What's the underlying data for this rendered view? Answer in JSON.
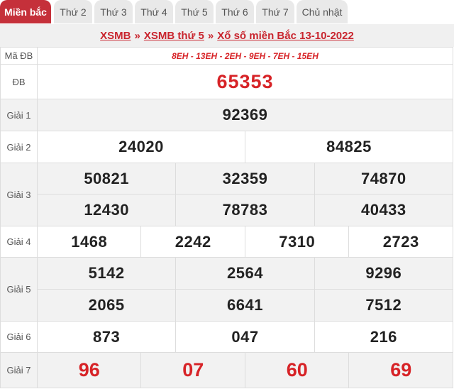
{
  "tabs": [
    {
      "label": "Miền bắc",
      "active": true
    },
    {
      "label": "Thứ 2"
    },
    {
      "label": "Thứ 3"
    },
    {
      "label": "Thứ 4"
    },
    {
      "label": "Thứ 5"
    },
    {
      "label": "Thứ 6"
    },
    {
      "label": "Thứ 7"
    },
    {
      "label": "Chủ nhật"
    }
  ],
  "breadcrumb": {
    "item1": "XSMB",
    "sep": "»",
    "item2": "XSMB thứ 5",
    "item3": "Xổ số miền Bắc 13-10-2022"
  },
  "colors": {
    "accent": "#c5303a",
    "prize_red": "#d72327"
  },
  "results": {
    "ma_db": {
      "label": "Mã ĐB",
      "value": "8EH - 13EH - 2EH - 9EH - 7EH - 15EH"
    },
    "db": {
      "label": "ĐB",
      "values": [
        "65353"
      ]
    },
    "giai1": {
      "label": "Giải 1",
      "values": [
        "92369"
      ]
    },
    "giai2": {
      "label": "Giải 2",
      "values": [
        "24020",
        "84825"
      ]
    },
    "giai3": {
      "label": "Giải 3",
      "values": [
        "50821",
        "32359",
        "74870",
        "12430",
        "78783",
        "40433"
      ]
    },
    "giai4": {
      "label": "Giải 4",
      "values": [
        "1468",
        "2242",
        "7310",
        "2723"
      ]
    },
    "giai5": {
      "label": "Giải 5",
      "values": [
        "5142",
        "2564",
        "9296",
        "2065",
        "6641",
        "7512"
      ]
    },
    "giai6": {
      "label": "Giải 6",
      "values": [
        "873",
        "047",
        "216"
      ]
    },
    "giai7": {
      "label": "Giải 7",
      "values": [
        "96",
        "07",
        "60",
        "69"
      ]
    }
  }
}
